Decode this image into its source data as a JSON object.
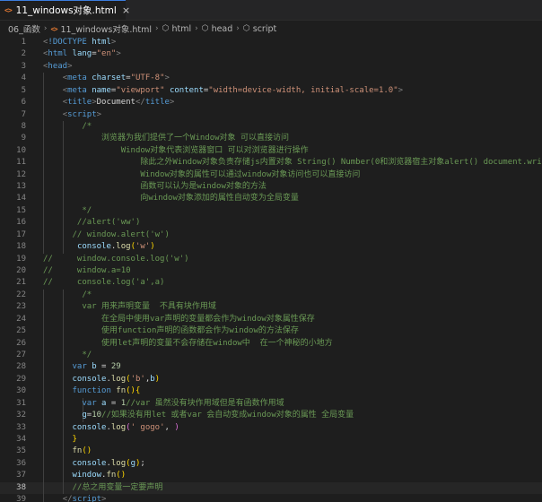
{
  "tab": {
    "icon": "html-file-icon",
    "icon_text": "<>",
    "title": "11_windows对象.html",
    "close": "×"
  },
  "breadcrumb": {
    "folder": "06_函数",
    "file": "11_windows对象.html",
    "html": "html",
    "head": "head",
    "script": "script",
    "sep": "›",
    "cube_icon": "⬡"
  },
  "editor": {
    "active_line": 38,
    "lines": [
      {
        "n": "1",
        "indent": 0,
        "tokens": [
          [
            "t-punc",
            "<"
          ],
          [
            "t-tag",
            "!DOCTYPE"
          ],
          [
            "t-txt",
            " "
          ],
          [
            "t-attr",
            "html"
          ],
          [
            "t-punc",
            ">"
          ]
        ]
      },
      {
        "n": "2",
        "indent": 0,
        "tokens": [
          [
            "t-punc",
            "<"
          ],
          [
            "t-tag",
            "html"
          ],
          [
            "t-txt",
            " "
          ],
          [
            "t-attr",
            "lang"
          ],
          [
            "t-txt",
            "="
          ],
          [
            "t-str",
            "\"en\""
          ],
          [
            "t-punc",
            ">"
          ]
        ]
      },
      {
        "n": "3",
        "indent": 0,
        "tokens": [
          [
            "t-punc",
            "<"
          ],
          [
            "t-tag",
            "head"
          ],
          [
            "t-punc",
            ">"
          ]
        ]
      },
      {
        "n": "4",
        "indent": 1,
        "tokens": [
          [
            "t-txt",
            "    "
          ],
          [
            "t-punc",
            "<"
          ],
          [
            "t-tag",
            "meta"
          ],
          [
            "t-txt",
            " "
          ],
          [
            "t-attr",
            "charset"
          ],
          [
            "t-txt",
            "="
          ],
          [
            "t-str",
            "\"UTF-8\""
          ],
          [
            "t-punc",
            ">"
          ]
        ]
      },
      {
        "n": "5",
        "indent": 1,
        "tokens": [
          [
            "t-txt",
            "    "
          ],
          [
            "t-punc",
            "<"
          ],
          [
            "t-tag",
            "meta"
          ],
          [
            "t-txt",
            " "
          ],
          [
            "t-attr",
            "name"
          ],
          [
            "t-txt",
            "="
          ],
          [
            "t-str",
            "\"viewport\""
          ],
          [
            "t-txt",
            " "
          ],
          [
            "t-attr",
            "content"
          ],
          [
            "t-txt",
            "="
          ],
          [
            "t-str",
            "\"width=device-width, initial-scale=1.0\""
          ],
          [
            "t-punc",
            ">"
          ]
        ]
      },
      {
        "n": "6",
        "indent": 1,
        "tokens": [
          [
            "t-txt",
            "    "
          ],
          [
            "t-punc",
            "<"
          ],
          [
            "t-tag",
            "title"
          ],
          [
            "t-punc",
            ">"
          ],
          [
            "t-txt",
            "Document"
          ],
          [
            "t-punc",
            "</"
          ],
          [
            "t-tag",
            "title"
          ],
          [
            "t-punc",
            ">"
          ]
        ]
      },
      {
        "n": "7",
        "indent": 1,
        "tokens": [
          [
            "t-txt",
            "    "
          ],
          [
            "t-punc",
            "<"
          ],
          [
            "t-tag",
            "script"
          ],
          [
            "t-punc",
            ">"
          ]
        ]
      },
      {
        "n": "8",
        "indent": 2,
        "tokens": [
          [
            "t-com",
            "        /*"
          ]
        ]
      },
      {
        "n": "9",
        "indent": 2,
        "tokens": [
          [
            "t-com",
            "            浏览器为我们提供了一个Window对象 可以直接访问"
          ]
        ]
      },
      {
        "n": "10",
        "indent": 2,
        "tokens": [
          [
            "t-com",
            "                Window对象代表浏览器窗口 可以对浏览器进行操作"
          ]
        ]
      },
      {
        "n": "11",
        "indent": 2,
        "tokens": [
          [
            "t-com",
            "                    除此之外Window对象负责存储js内置对象 String() Number(0和浏览器宿主对象alert() document.write()"
          ]
        ]
      },
      {
        "n": "12",
        "indent": 2,
        "tokens": [
          [
            "t-com",
            "                    Window对象的属性可以通过window对象访问也可以直接访问"
          ]
        ]
      },
      {
        "n": "13",
        "indent": 2,
        "tokens": [
          [
            "t-com",
            "                    函数可以认为是window对象的方法"
          ]
        ]
      },
      {
        "n": "14",
        "indent": 2,
        "tokens": [
          [
            "t-com",
            "                    向window对象添加的属性自动变为全局变量"
          ]
        ]
      },
      {
        "n": "15",
        "indent": 2,
        "tokens": [
          [
            "t-com",
            "        */"
          ]
        ]
      },
      {
        "n": "16",
        "indent": 2,
        "tokens": [
          [
            "t-com",
            "       //alert('ww')"
          ]
        ]
      },
      {
        "n": "17",
        "indent": 2,
        "tokens": [
          [
            "t-com",
            "      // window.alert('w')"
          ]
        ]
      },
      {
        "n": "18",
        "indent": 2,
        "tokens": [
          [
            "t-txt",
            "       "
          ],
          [
            "t-var",
            "console"
          ],
          [
            "t-txt",
            "."
          ],
          [
            "t-fn",
            "log"
          ],
          [
            "t-br1",
            "("
          ],
          [
            "t-str",
            "'w'"
          ],
          [
            "t-br1",
            ")"
          ]
        ]
      },
      {
        "n": "19",
        "indent": 0,
        "tokens": [
          [
            "t-com",
            "//     window.console.log('w')"
          ]
        ]
      },
      {
        "n": "20",
        "indent": 0,
        "tokens": [
          [
            "t-com",
            "//     window.a=10"
          ]
        ]
      },
      {
        "n": "21",
        "indent": 0,
        "tokens": [
          [
            "t-com",
            "//     console.log('a',a)"
          ]
        ]
      },
      {
        "n": "22",
        "indent": 2,
        "tokens": [
          [
            "t-com",
            "        /*"
          ]
        ]
      },
      {
        "n": "23",
        "indent": 2,
        "tokens": [
          [
            "t-com",
            "        var 用来声明变量  不具有块作用域"
          ]
        ]
      },
      {
        "n": "24",
        "indent": 2,
        "tokens": [
          [
            "t-com",
            "            在全局中使用var声明的变量都会作为window对象属性保存"
          ]
        ]
      },
      {
        "n": "25",
        "indent": 2,
        "tokens": [
          [
            "t-com",
            "            使用function声明的函数都会作为window的方法保存"
          ]
        ]
      },
      {
        "n": "26",
        "indent": 2,
        "tokens": [
          [
            "t-com",
            "            使用let声明的变量不会存储在window中  在一个神秘的小地方"
          ]
        ]
      },
      {
        "n": "27",
        "indent": 2,
        "tokens": [
          [
            "t-com",
            "        */"
          ]
        ]
      },
      {
        "n": "28",
        "indent": 2,
        "tokens": [
          [
            "t-txt",
            "      "
          ],
          [
            "t-kw",
            "var"
          ],
          [
            "t-txt",
            " "
          ],
          [
            "t-var",
            "b"
          ],
          [
            "t-txt",
            " = "
          ],
          [
            "t-num",
            "29"
          ]
        ]
      },
      {
        "n": "29",
        "indent": 2,
        "tokens": [
          [
            "t-txt",
            "      "
          ],
          [
            "t-var",
            "console"
          ],
          [
            "t-txt",
            "."
          ],
          [
            "t-fn",
            "log"
          ],
          [
            "t-br1",
            "("
          ],
          [
            "t-str",
            "'b'"
          ],
          [
            "t-txt",
            ","
          ],
          [
            "t-var",
            "b"
          ],
          [
            "t-br1",
            ")"
          ]
        ]
      },
      {
        "n": "30",
        "indent": 2,
        "tokens": [
          [
            "t-txt",
            "      "
          ],
          [
            "t-kw",
            "function"
          ],
          [
            "t-txt",
            " "
          ],
          [
            "t-fn",
            "fn"
          ],
          [
            "t-br1",
            "()"
          ],
          [
            "t-br1",
            "{"
          ]
        ]
      },
      {
        "n": "31",
        "indent": 3,
        "tokens": [
          [
            "t-txt",
            "        "
          ],
          [
            "t-kw",
            "var"
          ],
          [
            "t-txt",
            " "
          ],
          [
            "t-var",
            "a"
          ],
          [
            "t-txt",
            " = "
          ],
          [
            "t-num",
            "1"
          ],
          [
            "t-com",
            "//var 虽然没有块作用域但是有函数作用域"
          ]
        ]
      },
      {
        "n": "32",
        "indent": 3,
        "tokens": [
          [
            "t-txt",
            "        "
          ],
          [
            "t-var",
            "g"
          ],
          [
            "t-txt",
            "="
          ],
          [
            "t-num",
            "10"
          ],
          [
            "t-com",
            "//如果没有用let 或者var 会自动变成window对象的属性 全局变量"
          ]
        ]
      },
      {
        "n": "33",
        "indent": 2,
        "tokens": [
          [
            "t-txt",
            "      "
          ],
          [
            "t-var",
            "console"
          ],
          [
            "t-txt",
            "."
          ],
          [
            "t-fn",
            "log"
          ],
          [
            "t-br2",
            "("
          ],
          [
            "t-str",
            "' gogo'"
          ],
          [
            "t-txt",
            ", "
          ],
          [
            "t-br2",
            ")"
          ]
        ]
      },
      {
        "n": "34",
        "indent": 2,
        "tokens": [
          [
            "t-txt",
            "      "
          ],
          [
            "t-br1",
            "}"
          ]
        ]
      },
      {
        "n": "35",
        "indent": 2,
        "tokens": [
          [
            "t-txt",
            "      "
          ],
          [
            "t-fn",
            "fn"
          ],
          [
            "t-br1",
            "()"
          ]
        ]
      },
      {
        "n": "36",
        "indent": 2,
        "tokens": [
          [
            "t-txt",
            "      "
          ],
          [
            "t-var",
            "console"
          ],
          [
            "t-txt",
            "."
          ],
          [
            "t-fn",
            "log"
          ],
          [
            "t-br1",
            "("
          ],
          [
            "t-var",
            "g"
          ],
          [
            "t-br1",
            ")"
          ],
          [
            "t-txt",
            ";"
          ]
        ]
      },
      {
        "n": "37",
        "indent": 2,
        "tokens": [
          [
            "t-txt",
            "      "
          ],
          [
            "t-var",
            "window"
          ],
          [
            "t-txt",
            "."
          ],
          [
            "t-fn",
            "fn"
          ],
          [
            "t-br1",
            "()"
          ]
        ]
      },
      {
        "n": "38",
        "indent": 2,
        "tokens": [
          [
            "t-txt",
            "      "
          ],
          [
            "t-com",
            "//总之用变量一定要声明"
          ]
        ]
      },
      {
        "n": "39",
        "indent": 1,
        "tokens": [
          [
            "t-txt",
            "    "
          ],
          [
            "t-punc",
            "</"
          ],
          [
            "t-tag",
            "script"
          ],
          [
            "t-punc",
            ">"
          ]
        ]
      }
    ]
  }
}
